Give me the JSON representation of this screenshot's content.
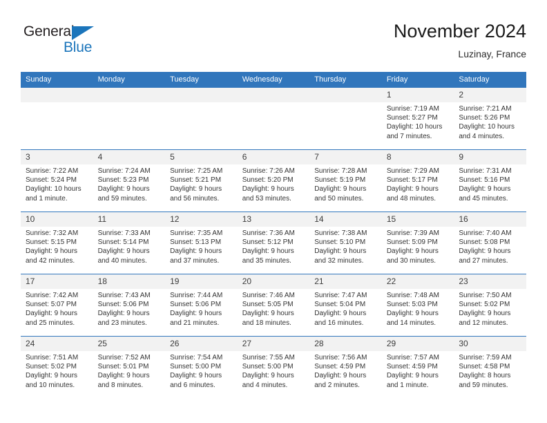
{
  "brand": {
    "name_part1": "General",
    "name_part2": "Blue",
    "accent_color": "#1b75bb"
  },
  "header": {
    "title": "November 2024",
    "location": "Luzinay, France",
    "header_bg_color": "#3176bc",
    "daynum_bg_color": "#f2f2f2"
  },
  "weekday_headers": [
    "Sunday",
    "Monday",
    "Tuesday",
    "Wednesday",
    "Thursday",
    "Friday",
    "Saturday"
  ],
  "labels": {
    "sunrise": "Sunrise:",
    "sunset": "Sunset:",
    "daylight": "Daylight:"
  },
  "weeks": [
    [
      {
        "day": "",
        "blank": true
      },
      {
        "day": "",
        "blank": true
      },
      {
        "day": "",
        "blank": true
      },
      {
        "day": "",
        "blank": true
      },
      {
        "day": "",
        "blank": true
      },
      {
        "day": "1",
        "sunrise": "Sunrise: 7:19 AM",
        "sunset": "Sunset: 5:27 PM",
        "daylight_line1": "Daylight: 10 hours",
        "daylight_line2": "and 7 minutes."
      },
      {
        "day": "2",
        "sunrise": "Sunrise: 7:21 AM",
        "sunset": "Sunset: 5:26 PM",
        "daylight_line1": "Daylight: 10 hours",
        "daylight_line2": "and 4 minutes."
      }
    ],
    [
      {
        "day": "3",
        "sunrise": "Sunrise: 7:22 AM",
        "sunset": "Sunset: 5:24 PM",
        "daylight_line1": "Daylight: 10 hours",
        "daylight_line2": "and 1 minute."
      },
      {
        "day": "4",
        "sunrise": "Sunrise: 7:24 AM",
        "sunset": "Sunset: 5:23 PM",
        "daylight_line1": "Daylight: 9 hours",
        "daylight_line2": "and 59 minutes."
      },
      {
        "day": "5",
        "sunrise": "Sunrise: 7:25 AM",
        "sunset": "Sunset: 5:21 PM",
        "daylight_line1": "Daylight: 9 hours",
        "daylight_line2": "and 56 minutes."
      },
      {
        "day": "6",
        "sunrise": "Sunrise: 7:26 AM",
        "sunset": "Sunset: 5:20 PM",
        "daylight_line1": "Daylight: 9 hours",
        "daylight_line2": "and 53 minutes."
      },
      {
        "day": "7",
        "sunrise": "Sunrise: 7:28 AM",
        "sunset": "Sunset: 5:19 PM",
        "daylight_line1": "Daylight: 9 hours",
        "daylight_line2": "and 50 minutes."
      },
      {
        "day": "8",
        "sunrise": "Sunrise: 7:29 AM",
        "sunset": "Sunset: 5:17 PM",
        "daylight_line1": "Daylight: 9 hours",
        "daylight_line2": "and 48 minutes."
      },
      {
        "day": "9",
        "sunrise": "Sunrise: 7:31 AM",
        "sunset": "Sunset: 5:16 PM",
        "daylight_line1": "Daylight: 9 hours",
        "daylight_line2": "and 45 minutes."
      }
    ],
    [
      {
        "day": "10",
        "sunrise": "Sunrise: 7:32 AM",
        "sunset": "Sunset: 5:15 PM",
        "daylight_line1": "Daylight: 9 hours",
        "daylight_line2": "and 42 minutes."
      },
      {
        "day": "11",
        "sunrise": "Sunrise: 7:33 AM",
        "sunset": "Sunset: 5:14 PM",
        "daylight_line1": "Daylight: 9 hours",
        "daylight_line2": "and 40 minutes."
      },
      {
        "day": "12",
        "sunrise": "Sunrise: 7:35 AM",
        "sunset": "Sunset: 5:13 PM",
        "daylight_line1": "Daylight: 9 hours",
        "daylight_line2": "and 37 minutes."
      },
      {
        "day": "13",
        "sunrise": "Sunrise: 7:36 AM",
        "sunset": "Sunset: 5:12 PM",
        "daylight_line1": "Daylight: 9 hours",
        "daylight_line2": "and 35 minutes."
      },
      {
        "day": "14",
        "sunrise": "Sunrise: 7:38 AM",
        "sunset": "Sunset: 5:10 PM",
        "daylight_line1": "Daylight: 9 hours",
        "daylight_line2": "and 32 minutes."
      },
      {
        "day": "15",
        "sunrise": "Sunrise: 7:39 AM",
        "sunset": "Sunset: 5:09 PM",
        "daylight_line1": "Daylight: 9 hours",
        "daylight_line2": "and 30 minutes."
      },
      {
        "day": "16",
        "sunrise": "Sunrise: 7:40 AM",
        "sunset": "Sunset: 5:08 PM",
        "daylight_line1": "Daylight: 9 hours",
        "daylight_line2": "and 27 minutes."
      }
    ],
    [
      {
        "day": "17",
        "sunrise": "Sunrise: 7:42 AM",
        "sunset": "Sunset: 5:07 PM",
        "daylight_line1": "Daylight: 9 hours",
        "daylight_line2": "and 25 minutes."
      },
      {
        "day": "18",
        "sunrise": "Sunrise: 7:43 AM",
        "sunset": "Sunset: 5:06 PM",
        "daylight_line1": "Daylight: 9 hours",
        "daylight_line2": "and 23 minutes."
      },
      {
        "day": "19",
        "sunrise": "Sunrise: 7:44 AM",
        "sunset": "Sunset: 5:06 PM",
        "daylight_line1": "Daylight: 9 hours",
        "daylight_line2": "and 21 minutes."
      },
      {
        "day": "20",
        "sunrise": "Sunrise: 7:46 AM",
        "sunset": "Sunset: 5:05 PM",
        "daylight_line1": "Daylight: 9 hours",
        "daylight_line2": "and 18 minutes."
      },
      {
        "day": "21",
        "sunrise": "Sunrise: 7:47 AM",
        "sunset": "Sunset: 5:04 PM",
        "daylight_line1": "Daylight: 9 hours",
        "daylight_line2": "and 16 minutes."
      },
      {
        "day": "22",
        "sunrise": "Sunrise: 7:48 AM",
        "sunset": "Sunset: 5:03 PM",
        "daylight_line1": "Daylight: 9 hours",
        "daylight_line2": "and 14 minutes."
      },
      {
        "day": "23",
        "sunrise": "Sunrise: 7:50 AM",
        "sunset": "Sunset: 5:02 PM",
        "daylight_line1": "Daylight: 9 hours",
        "daylight_line2": "and 12 minutes."
      }
    ],
    [
      {
        "day": "24",
        "sunrise": "Sunrise: 7:51 AM",
        "sunset": "Sunset: 5:02 PM",
        "daylight_line1": "Daylight: 9 hours",
        "daylight_line2": "and 10 minutes."
      },
      {
        "day": "25",
        "sunrise": "Sunrise: 7:52 AM",
        "sunset": "Sunset: 5:01 PM",
        "daylight_line1": "Daylight: 9 hours",
        "daylight_line2": "and 8 minutes."
      },
      {
        "day": "26",
        "sunrise": "Sunrise: 7:54 AM",
        "sunset": "Sunset: 5:00 PM",
        "daylight_line1": "Daylight: 9 hours",
        "daylight_line2": "and 6 minutes."
      },
      {
        "day": "27",
        "sunrise": "Sunrise: 7:55 AM",
        "sunset": "Sunset: 5:00 PM",
        "daylight_line1": "Daylight: 9 hours",
        "daylight_line2": "and 4 minutes."
      },
      {
        "day": "28",
        "sunrise": "Sunrise: 7:56 AM",
        "sunset": "Sunset: 4:59 PM",
        "daylight_line1": "Daylight: 9 hours",
        "daylight_line2": "and 2 minutes."
      },
      {
        "day": "29",
        "sunrise": "Sunrise: 7:57 AM",
        "sunset": "Sunset: 4:59 PM",
        "daylight_line1": "Daylight: 9 hours",
        "daylight_line2": "and 1 minute."
      },
      {
        "day": "30",
        "sunrise": "Sunrise: 7:59 AM",
        "sunset": "Sunset: 4:58 PM",
        "daylight_line1": "Daylight: 8 hours",
        "daylight_line2": "and 59 minutes."
      }
    ]
  ]
}
